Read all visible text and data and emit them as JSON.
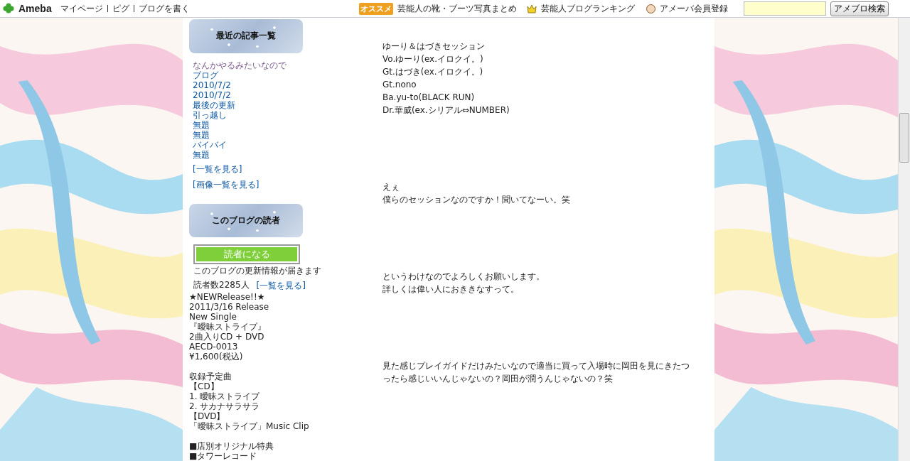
{
  "top_bar": {
    "logo": "Ameba",
    "nav": [
      "マイページ",
      "ピグ",
      "ブログを書く"
    ],
    "promo_badge": "オススメ",
    "promo_link": "芸能人の靴・ブーツ写真まとめ",
    "ranking_link": "芸能人ブログランキング",
    "register_link": "アメーバ会員登録",
    "search_button": "アメブロ検索"
  },
  "sidebar": {
    "recent": {
      "title": "最近の記事一覧",
      "items": [
        {
          "label": "なんかやるみたいなので",
          "visited": true
        },
        {
          "label": "ブログ",
          "visited": false
        },
        {
          "label": "2010/7/2",
          "visited": false
        },
        {
          "label": "2010/7/2",
          "visited": false
        },
        {
          "label": "最後の更新",
          "visited": false
        },
        {
          "label": "引っ越し",
          "visited": false
        },
        {
          "label": "無題",
          "visited": false
        },
        {
          "label": "無題",
          "visited": false
        },
        {
          "label": "バイバイ",
          "visited": false
        },
        {
          "label": "無題",
          "visited": false
        }
      ],
      "links": [
        "[一覧を見る]",
        "[画像一覧を見る]"
      ]
    },
    "readers": {
      "title": "このブログの読者",
      "button": "読者になる",
      "note": "このブログの更新情報が届きます",
      "count": "読者数2285人",
      "list_link": "[一覧を見る]"
    },
    "free_text": [
      [
        "★NEWRelease!!★",
        "2011/3/16 Release",
        "New Single",
        "『曖昧ストライプ』",
        "2曲入りCD + DVD",
        "AECD-0013",
        "¥1,600(税込)"
      ],
      [
        "収録予定曲",
        "【CD】",
        "1. 曖昧ストライプ",
        "2. サカナサラサラ",
        "【DVD】",
        "「曖昧ストライプ」Music Clip"
      ],
      [
        "■店別オリジナル特典",
        "■タワーレコード"
      ]
    ]
  },
  "article": {
    "paragraphs": [
      [
        "ゆーり＆はづきセッション",
        "Vo.ゆーり(ex.イロクイ。)",
        "Gt.はづき(ex.イロクイ。)",
        "Gt.nono",
        "Ba.yu-to(BLACK RUN)",
        "Dr.華威(ex.シリアル⇔NUMBER)"
      ],
      [
        "えぇ",
        "僕らのセッションなのですか！聞いてなーい。笑"
      ],
      [
        "というわけなのでよろしくお願いします。",
        "詳しくは偉い人におききなすって。"
      ],
      [
        "見た感じプレイガイドだけみたいなので適当に買って入場時に岡田を見にきたつったら感じいいんじゃないの？岡田が潤うんじゃないの？笑"
      ]
    ]
  }
}
